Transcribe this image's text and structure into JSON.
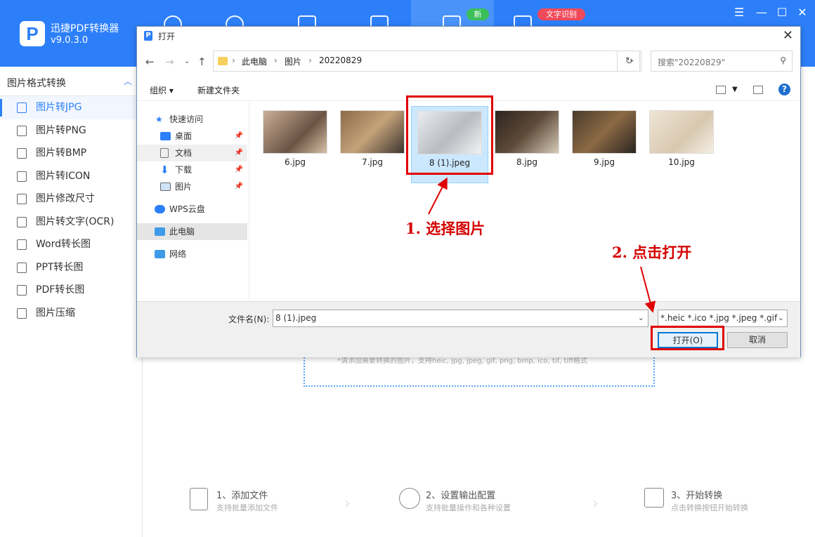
{
  "app": {
    "name": "迅捷PDF转换器",
    "version": "v9.0.3.0",
    "logo_letter": "P",
    "badge_new": "新",
    "badge_ocr": "文字识别",
    "accent": "#2d7ff9"
  },
  "sidebar": {
    "header": "图片格式转换",
    "items": [
      {
        "label": "图片转JPG",
        "active": true
      },
      {
        "label": "图片转PNG"
      },
      {
        "label": "图片转BMP"
      },
      {
        "label": "图片转ICON"
      },
      {
        "label": "图片修改尺寸"
      },
      {
        "label": "图片转文字(OCR)"
      },
      {
        "label": "Word转长图"
      },
      {
        "label": "PPT转长图"
      },
      {
        "label": "PDF转长图"
      },
      {
        "label": "图片压缩"
      }
    ]
  },
  "main": {
    "drop_note": "*请添加需要转换的图片，支持heic, jpg, jpeg, gif, png, bmp, ico, tif, tiff格式",
    "steps": [
      {
        "title": "1、添加文件",
        "sub": "支持批量添加文件"
      },
      {
        "title": "2、设置输出配置",
        "sub": "支持批量操作和各种设置"
      },
      {
        "title": "3、开始转换",
        "sub": "点击转换按钮开始转换"
      }
    ]
  },
  "dialog": {
    "title": "打开",
    "breadcrumb": [
      "此电脑",
      "图片",
      "20220829"
    ],
    "search_placeholder": "搜索\"20220829\"",
    "organize": "组织",
    "new_folder": "新建文件夹",
    "tree": [
      {
        "label": "快速访问",
        "icon": "star-icon"
      },
      {
        "label": "桌面",
        "icon": "desktop-icon",
        "pinned": true
      },
      {
        "label": "文档",
        "icon": "document-icon",
        "pinned": true
      },
      {
        "label": "下载",
        "icon": "download-icon",
        "pinned": true
      },
      {
        "label": "图片",
        "icon": "pictures-icon",
        "pinned": true
      },
      {
        "label": "WPS云盘",
        "icon": "cloud-icon"
      },
      {
        "label": "此电脑",
        "icon": "computer-icon",
        "selected": true
      },
      {
        "label": "网络",
        "icon": "network-icon"
      }
    ],
    "files": [
      {
        "name": "6.jpg"
      },
      {
        "name": "7.jpg"
      },
      {
        "name": "8 (1).jpeg",
        "selected": true
      },
      {
        "name": "8.jpg"
      },
      {
        "name": "9.jpg"
      },
      {
        "name": "10.jpg"
      }
    ],
    "filename_label": "文件名(N):",
    "filename_value": "8 (1).jpeg",
    "filetype_value": "*.heic *.ico *.jpg *.jpeg *.gif *",
    "open_button": "打开(O)",
    "cancel_button": "取消"
  },
  "annotations": {
    "step1": "1. 选择图片",
    "step2": "2. 点击打开"
  }
}
